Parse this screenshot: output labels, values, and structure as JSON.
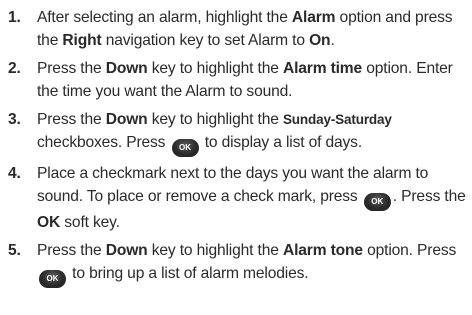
{
  "steps": [
    {
      "num": "1.",
      "t1": "After selecting an alarm, highlight the ",
      "b1": "Alarm",
      "t2": " option and press the ",
      "b2": "Right",
      "t3": " navigation key to set Alarm to ",
      "b3": "On",
      "t4": "."
    },
    {
      "num": "2.",
      "t1": "Press the ",
      "b1": "Down",
      "t2": " key to highlight the ",
      "b2": "Alarm time",
      "t3": " option. Enter the time you want the Alarm to sound."
    },
    {
      "num": "3.",
      "t1": "Press the ",
      "b1": "Down",
      "t2": " key to highlight the ",
      "b2": "Sunday-Saturday",
      "t3": " checkboxes. Press ",
      "t4": " to display a list of days."
    },
    {
      "num": "4.",
      "t1": "Place a checkmark next to the days you want the alarm to sound. To place or remove a check mark, press ",
      "t2": ". Press the ",
      "b1": "OK",
      "t3": " soft key."
    },
    {
      "num": "5.",
      "t1": "Press the ",
      "b1": "Down",
      "t2": " key to highlight the ",
      "b2": "Alarm tone",
      "t3": " option. Press ",
      "t4": " to bring up a list of alarm melodies."
    }
  ],
  "ok_key_label": "OK",
  "ok_key_icon": "ok-key-icon"
}
